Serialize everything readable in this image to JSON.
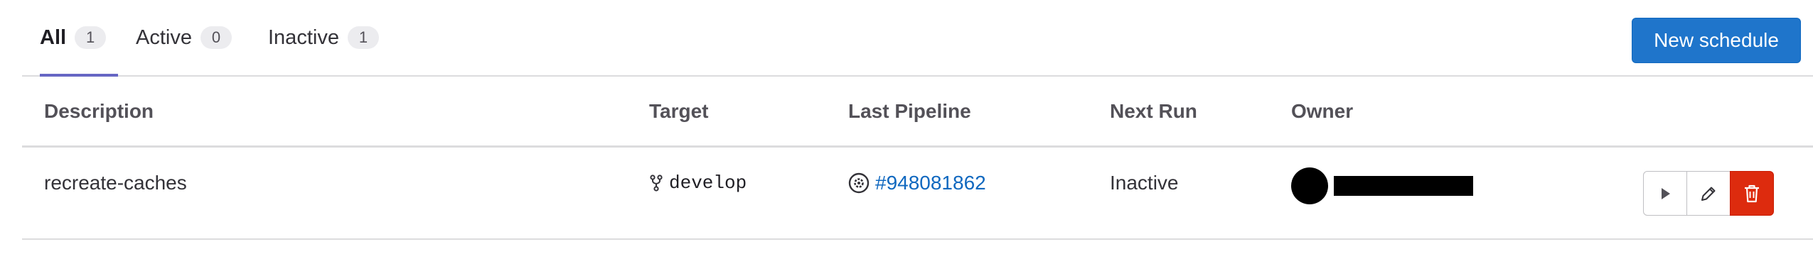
{
  "tabs": [
    {
      "label": "All",
      "count": "1"
    },
    {
      "label": "Active",
      "count": "0"
    },
    {
      "label": "Inactive",
      "count": "1"
    }
  ],
  "new_schedule_label": "New schedule",
  "table": {
    "headers": {
      "description": "Description",
      "target": "Target",
      "last_pipeline": "Last Pipeline",
      "next_run": "Next Run",
      "owner": "Owner"
    },
    "rows": [
      {
        "description": "recreate-caches",
        "target": "develop",
        "last_pipeline": "#948081862",
        "next_run": "Inactive"
      }
    ]
  },
  "icons": {
    "branch": "branch-icon",
    "pipeline_status": "status-scheduled-icon",
    "play": "play-icon",
    "edit": "pencil-icon",
    "delete": "trash-icon"
  },
  "colors": {
    "primary": "#1f75cb",
    "link": "#1068bf",
    "danger": "#dd2b0e",
    "active_tab_indicator": "#6666c4"
  }
}
